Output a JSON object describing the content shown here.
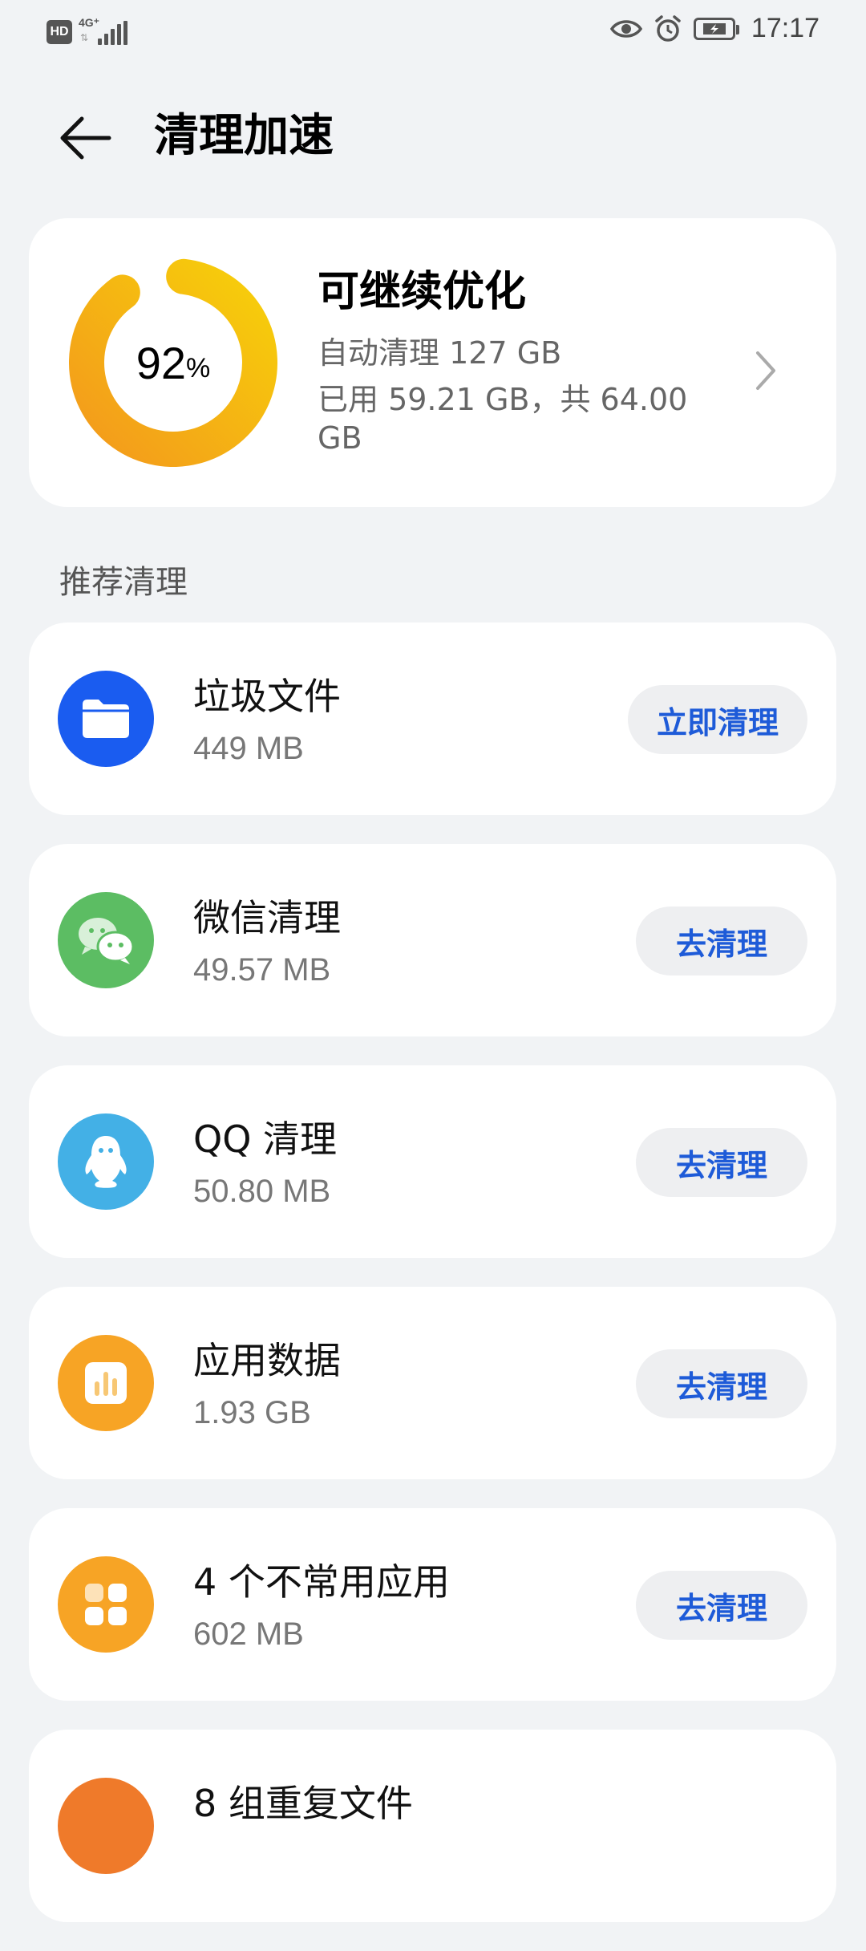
{
  "status_bar": {
    "hd": "HD",
    "network": "4G⁺",
    "time": "17:17"
  },
  "header": {
    "title": "清理加速"
  },
  "summary": {
    "percent": "92",
    "percent_unit": "%",
    "usage_fraction": 0.92,
    "title": "可继续优化",
    "auto_cleaned": "自动清理 127 GB",
    "storage": "已用 59.21 GB，共 64.00 GB"
  },
  "section": {
    "title": "推荐清理"
  },
  "items": [
    {
      "title": "垃圾文件",
      "size": "449 MB",
      "button": "立即清理",
      "icon": "folder-icon",
      "color": "#1a5cf0"
    },
    {
      "title": "微信清理",
      "size": "49.57 MB",
      "button": "去清理",
      "icon": "wechat-icon",
      "color": "#5cbd63"
    },
    {
      "title": "QQ 清理",
      "size": "50.80 MB",
      "button": "去清理",
      "icon": "qq-penguin-icon",
      "color": "#43b0e6"
    },
    {
      "title": "应用数据",
      "size": "1.93 GB",
      "button": "去清理",
      "icon": "app-data-icon",
      "color": "#f7a425"
    },
    {
      "title": "4 个不常用应用",
      "size": "602 MB",
      "button": "去清理",
      "icon": "apps-grid-icon",
      "color": "#f7a425"
    },
    {
      "title": "8 组重复文件",
      "size": "",
      "button": "",
      "icon": "duplicate-files-icon",
      "color": "#ef7a2a"
    }
  ]
}
